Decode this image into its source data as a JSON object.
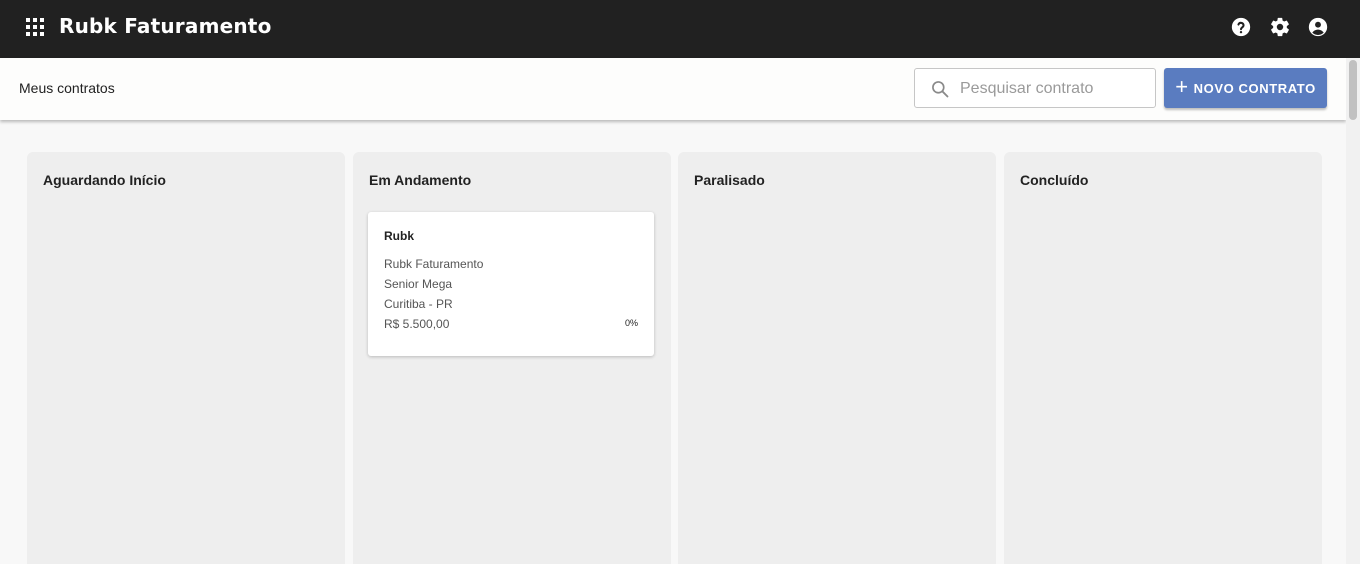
{
  "app": {
    "title": "Rubk Faturamento"
  },
  "header": {
    "page_title": "Meus contratos"
  },
  "search": {
    "placeholder": "Pesquisar contrato",
    "value": ""
  },
  "toolbar": {
    "new_contract_label": "NOVO CONTRATO"
  },
  "icons": {
    "apps": "apps-grid-icon",
    "help": "help-icon",
    "settings": "gear-icon",
    "account": "account-circle-icon",
    "search": "search-icon",
    "plus": "plus-icon"
  },
  "colors": {
    "topbar": "#212121",
    "accent": "#5a7cc0",
    "column_bg": "#eeeeee"
  },
  "columns": [
    {
      "title": "Aguardando Início",
      "cards": []
    },
    {
      "title": "Em Andamento",
      "cards": [
        {
          "title": "Rubk",
          "company": "Rubk Faturamento",
          "system": "Senior Mega",
          "location": "Curitiba - PR",
          "value": "R$ 5.500,00",
          "progress": "0%"
        }
      ]
    },
    {
      "title": "Paralisado",
      "cards": []
    },
    {
      "title": "Concluído",
      "cards": []
    }
  ]
}
